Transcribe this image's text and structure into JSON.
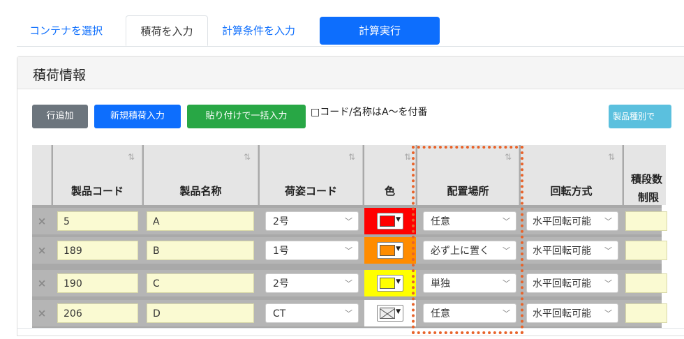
{
  "tabs": [
    {
      "label": "コンテナを選択"
    },
    {
      "label": "積荷を入力"
    },
    {
      "label": "計算条件を入力"
    },
    {
      "label": "計算実行"
    }
  ],
  "card": {
    "title": "積荷情報"
  },
  "toolbar": {
    "add_row": "行追加",
    "new_cargo": "新規積荷入力",
    "paste_bulk": "貼り付けで一括入力",
    "auto_number": "□コード/名称はA～を付番",
    "product_type": "製品種別で"
  },
  "columns": [
    "製品コード",
    "製品名称",
    "荷姿コード",
    "色",
    "配置場所",
    "回転方式",
    "積段数",
    "制限"
  ],
  "rows": [
    {
      "code": "5",
      "name": "A",
      "pack": "2号",
      "color": "#ff0000",
      "placement": "任意",
      "rotation": "水平回転可能"
    },
    {
      "code": "189",
      "name": "B",
      "pack": "1号",
      "color": "#ff8c00",
      "placement": "必ず上に置く",
      "rotation": "水平回転可能"
    },
    {
      "code": "190",
      "name": "C",
      "pack": "2号",
      "color": "#ffff00",
      "placement": "単独",
      "rotation": "水平回転可能"
    },
    {
      "code": "206",
      "name": "D",
      "pack": "CT",
      "color": "",
      "placement": "任意",
      "rotation": "水平回転可能"
    }
  ],
  "icons": {
    "delete": "×",
    "sort": "⇅",
    "caret": "﹀",
    "swatch_arrow": "▼"
  },
  "colors": {
    "highlight": "#e8632a",
    "primary": "#0d6efd",
    "success": "#28a745"
  }
}
